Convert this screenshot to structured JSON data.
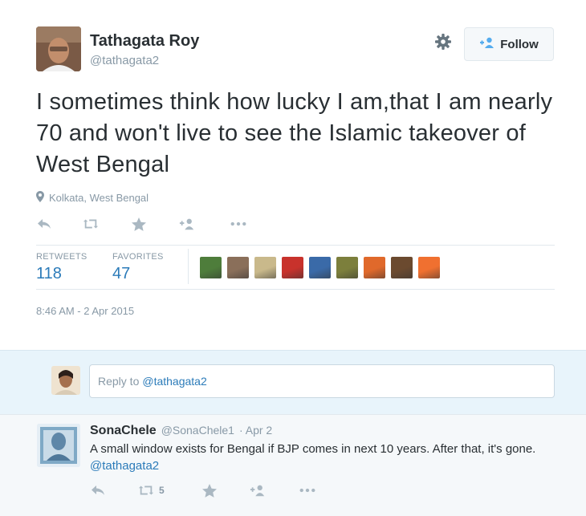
{
  "tweet": {
    "author_name": "Tathagata Roy",
    "author_handle": "@tathagata2",
    "follow_label": "Follow",
    "text": "I sometimes think how lucky I am,that I am nearly 70 and won't live to see the Islamic takeover of West Bengal",
    "location": "Kolkata, West Bengal",
    "retweets_label": "RETWEETS",
    "retweets_count": "118",
    "favorites_label": "FAVORITES",
    "favorites_count": "47",
    "timestamp": "8:46 AM - 2 Apr 2015",
    "action_icons": [
      "reply-icon",
      "retweet-icon",
      "favorite-icon",
      "follow-icon",
      "more-icon"
    ],
    "favoriter_colors": [
      "#4e7d3b",
      "#8a6f5a",
      "#c9b98b",
      "#c8322c",
      "#3a6aa8",
      "#7c7f3c",
      "#e0692b",
      "#6b4a2f",
      "#f07030"
    ]
  },
  "reply_box": {
    "prefix": "Reply to",
    "mention": "@tathagata2"
  },
  "replies": [
    {
      "name": "SonaChele",
      "handle": "@SonaChele1",
      "date": "· Apr 2",
      "text": "A small window exists for Bengal if BJP comes in next 10 years. After that, it's gone.",
      "mention": "@tathagata2",
      "retweet_count": "5"
    }
  ],
  "colors": {
    "link": "#2b7bb9",
    "muted": "#8899a6",
    "reply_bg": "#e8f4fb"
  }
}
